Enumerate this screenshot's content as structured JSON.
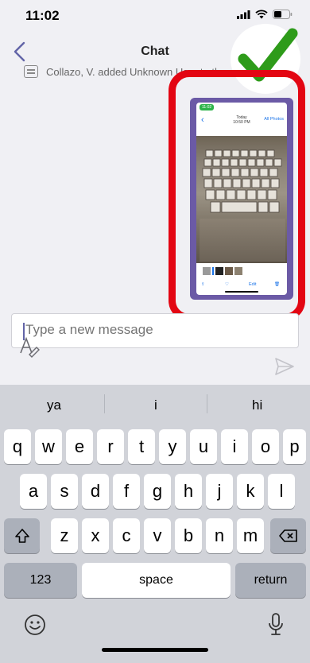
{
  "status": {
    "time": "11:02"
  },
  "nav": {
    "title": "Chat"
  },
  "system_message": "Collazo, V. added Unknown User to the chat.",
  "shared_image": {
    "time": "11:02",
    "title": "Today",
    "subtitle": "10:50 PM",
    "all_photos": "All Photos",
    "edit": "Edit"
  },
  "compose": {
    "placeholder": "Type a new message"
  },
  "keyboard": {
    "suggestions": [
      "ya",
      "i",
      "hi"
    ],
    "row1": [
      "q",
      "w",
      "e",
      "r",
      "t",
      "y",
      "u",
      "i",
      "o",
      "p"
    ],
    "row2": [
      "a",
      "s",
      "d",
      "f",
      "g",
      "h",
      "j",
      "k",
      "l"
    ],
    "row3": [
      "z",
      "x",
      "c",
      "v",
      "b",
      "n",
      "m"
    ],
    "numbers_label": "123",
    "space_label": "space",
    "return_label": "return"
  },
  "colors": {
    "accent": "#6264a7",
    "annotation_red": "#e30613",
    "check_green": "#2e9b1a"
  },
  "icons": {
    "back": "chevron-left-icon",
    "format": "format-text-icon",
    "send": "send-icon",
    "shift": "shift-icon",
    "backspace": "backspace-icon",
    "emoji": "emoji-icon",
    "mic": "microphone-icon"
  }
}
